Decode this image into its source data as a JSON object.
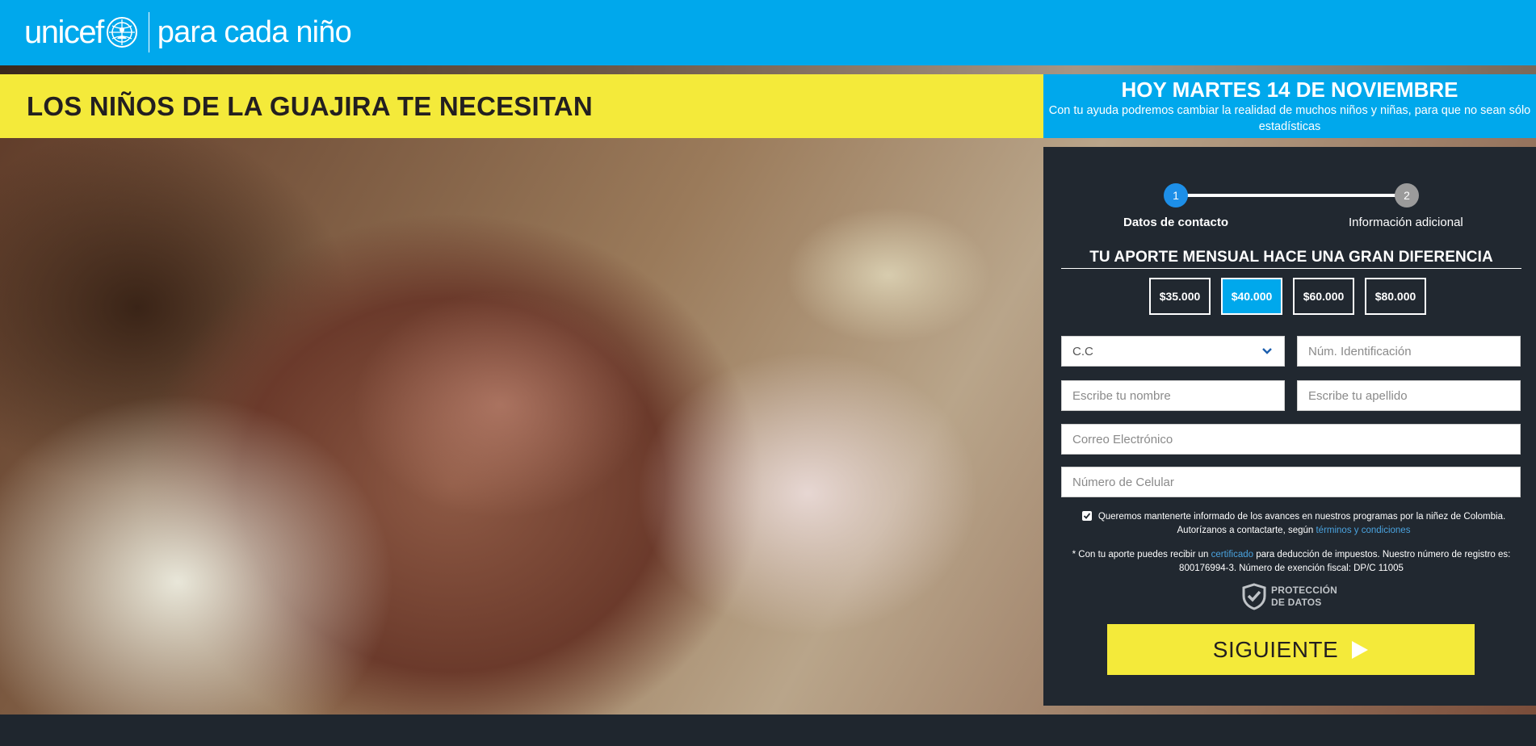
{
  "header": {
    "logo_word": "unicef",
    "tagline": "para cada niño",
    "emblem_icon": "un-emblem-icon"
  },
  "banner": {
    "headline": "LOS NIÑOS DE LA GUAJIRA TE NECESITAN"
  },
  "info": {
    "date": "HOY MARTES 14 DE NOVIEMBRE",
    "subtitle": "Con tu ayuda podremos cambiar la realidad de muchos niños y niñas, para que no sean sólo estadísticas"
  },
  "stepper": {
    "steps": [
      {
        "number": "1",
        "label": "Datos de contacto",
        "active": true
      },
      {
        "number": "2",
        "label": "Información adicional",
        "active": false
      }
    ]
  },
  "form": {
    "section_title": "TU APORTE MENSUAL HACE UNA GRAN DIFERENCIA",
    "amounts": [
      {
        "label": "$35.000",
        "selected": false
      },
      {
        "label": "$40.000",
        "selected": true
      },
      {
        "label": "$60.000",
        "selected": false
      },
      {
        "label": "$80.000",
        "selected": false
      }
    ],
    "doc_type": {
      "value": "C.C"
    },
    "id_number": {
      "placeholder": "Núm. Identificación"
    },
    "first_name": {
      "placeholder": "Escribe tu nombre"
    },
    "last_name": {
      "placeholder": "Escribe tu apellido"
    },
    "email": {
      "placeholder": "Correo Electrónico"
    },
    "phone": {
      "placeholder": "Número de Celular"
    },
    "consent": {
      "checked": true,
      "text_before": "Queremos mantenerte informado de los avances en nuestros programas por la niñez de Colombia. Autorízanos a contactarte, según ",
      "link": "términos y condiciones"
    },
    "tax_note": {
      "before": "* Con tu aporte puedes recibir un ",
      "link": "certificado",
      "after": " para deducción de impuestos. Nuestro número de registro es: 800176994-3. Número de exención fiscal: DP/C 11005"
    },
    "protection": {
      "line1": "PROTECCIÓN",
      "line2": "DE DATOS"
    },
    "next_label": "SIGUIENTE"
  },
  "colors": {
    "brand_blue": "#00a8ec",
    "banner_yellow": "#f4ea3a",
    "panel_dark": "#212830",
    "step_active": "#1d8fe8"
  }
}
